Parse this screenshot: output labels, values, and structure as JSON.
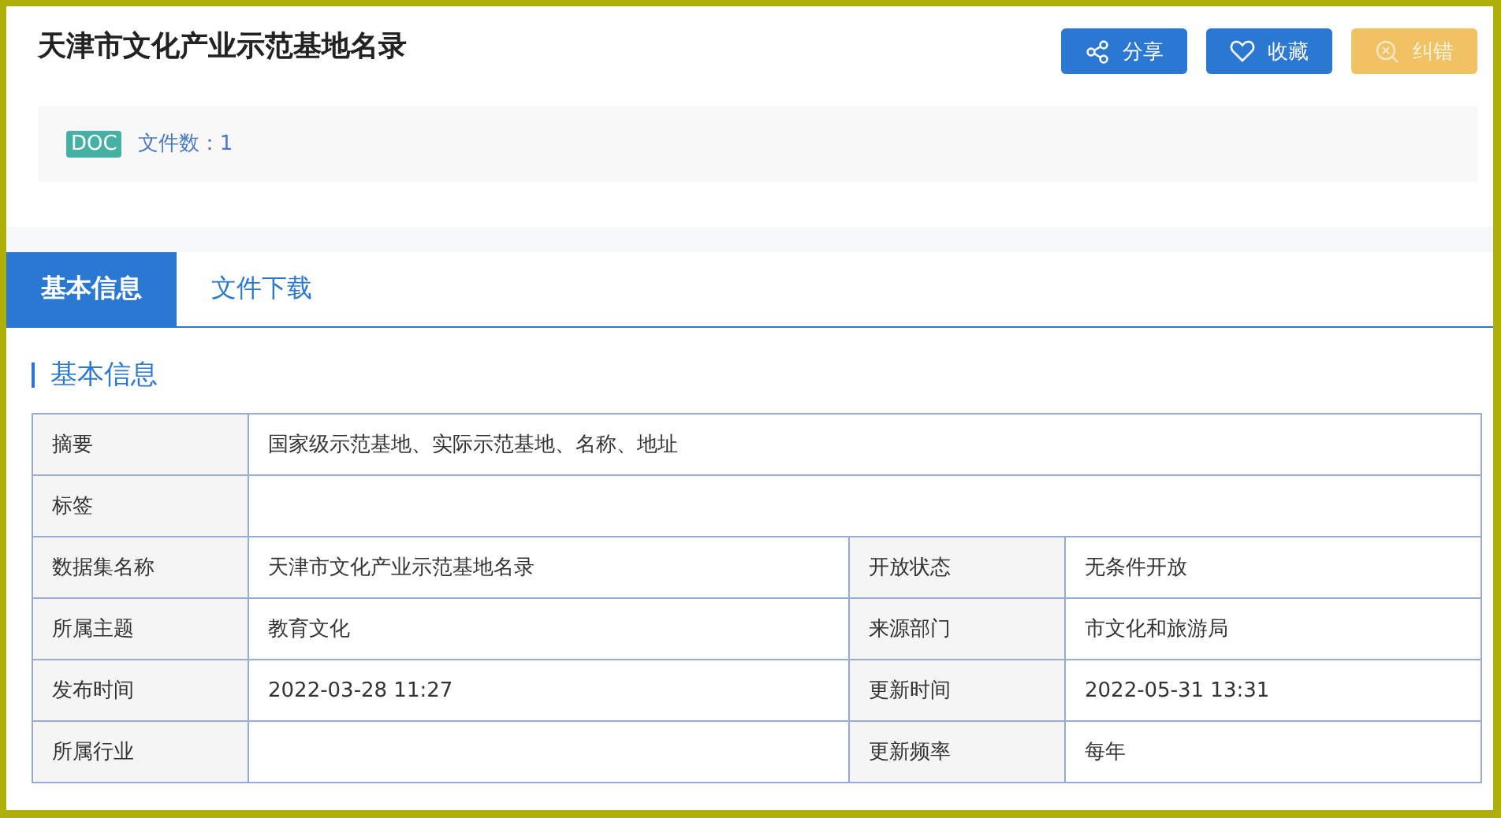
{
  "header": {
    "title": "天津市文化产业示范基地名录",
    "buttons": [
      {
        "label": "分享",
        "kind": "share"
      },
      {
        "label": "收藏",
        "kind": "favorite"
      },
      {
        "label": "纠错",
        "kind": "correct"
      }
    ],
    "format_badge": "DOC",
    "file_count": "文件数：1"
  },
  "tabs": [
    {
      "label": "基本信息",
      "selected": true
    },
    {
      "label": "文件下载",
      "selected": false
    }
  ],
  "section_title": "基本信息",
  "table": {
    "rows": [
      {
        "fields": [
          {
            "label": "摘要",
            "value": "国家级示范基地、实际示范基地、名称、地址"
          }
        ]
      },
      {
        "fields": [
          {
            "label": "标签"
          }
        ]
      },
      {
        "fields": [
          {
            "label": "数据集名称",
            "value": "天津市文化产业示范基地名录"
          },
          {
            "label": "开放状态",
            "value": "无条件开放"
          }
        ]
      },
      {
        "fields": [
          {
            "label": "所属主题",
            "value": "教育文化"
          },
          {
            "label": "来源部门",
            "value": "市文化和旅游局"
          }
        ]
      },
      {
        "fields": [
          {
            "label": "发布时间",
            "value": "2022-03-28 11:27"
          },
          {
            "label": "更新时间",
            "value": "2022-05-31 13:31"
          }
        ]
      },
      {
        "fields": [
          {
            "label": "所属行业"
          },
          {
            "label": "更新频率",
            "value": "每年"
          }
        ]
      }
    ]
  }
}
